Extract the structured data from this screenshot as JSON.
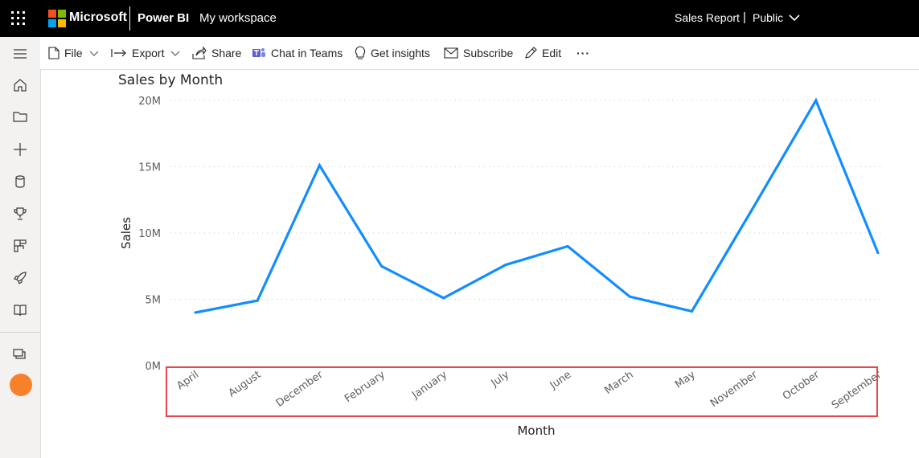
{
  "header": {
    "company": "Microsoft",
    "product": "Power BI",
    "workspace": "My workspace",
    "report_name": "Sales Report",
    "separator": "|",
    "visibility": "Public"
  },
  "toolbar": {
    "items": [
      {
        "label": "File",
        "icon": "file-icon",
        "has_dropdown": true
      },
      {
        "label": "Export",
        "icon": "export-icon",
        "has_dropdown": true
      },
      {
        "label": "Share",
        "icon": "share-icon"
      },
      {
        "label": "Chat in Teams",
        "icon": "teams-icon"
      },
      {
        "label": "Get insights",
        "icon": "lightbulb-icon"
      },
      {
        "label": "Subscribe",
        "icon": "mail-icon"
      },
      {
        "label": "Edit",
        "icon": "pencil-icon"
      }
    ],
    "more_label": "···"
  },
  "rail": {
    "icons": [
      "hamburger-icon",
      "home-icon",
      "folder-icon",
      "plus-icon",
      "datahub-icon",
      "trophy-icon",
      "apps-icon",
      "rocket-icon",
      "book-icon",
      "workspaces-icon"
    ]
  },
  "colors": {
    "line": "#118DFF",
    "highlight": "#E8464C",
    "avatar": "#F7812A"
  },
  "chart_data": {
    "type": "line",
    "title": "Sales by Month",
    "xlabel": "Month",
    "ylabel": "Sales",
    "categories": [
      "April",
      "August",
      "December",
      "February",
      "January",
      "July",
      "June",
      "March",
      "May",
      "November",
      "October",
      "September"
    ],
    "values": [
      4000000,
      4900000,
      15100000,
      7500000,
      5100000,
      7600000,
      9000000,
      5200000,
      4100000,
      12000000,
      20000000,
      8500000
    ],
    "ylim": [
      0,
      20000000
    ],
    "yticks": [
      0,
      5000000,
      10000000,
      15000000,
      20000000
    ],
    "ytick_labels": [
      "0M",
      "5M",
      "10M",
      "15M",
      "20M"
    ],
    "grid": true
  }
}
